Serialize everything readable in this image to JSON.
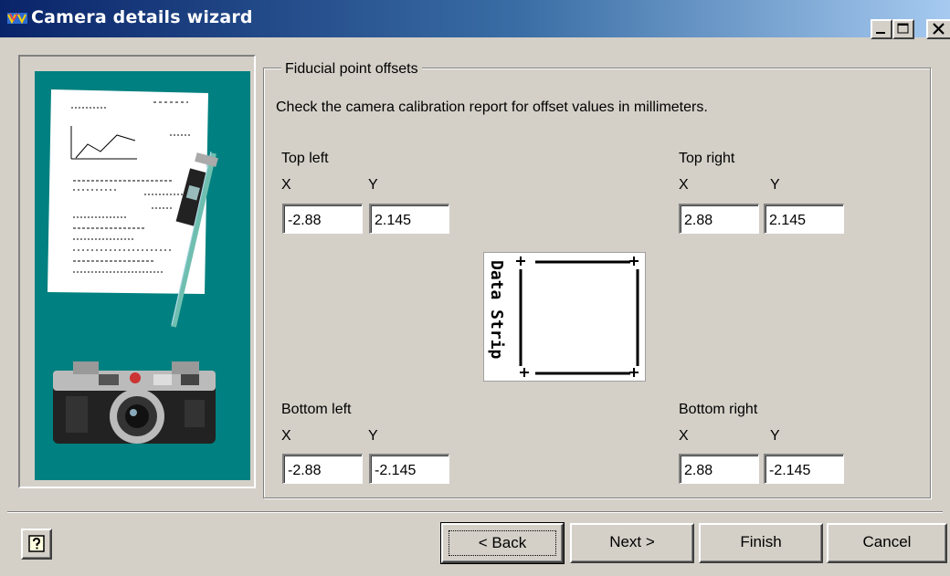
{
  "window": {
    "title": "Camera details wizard"
  },
  "group": {
    "legend": "Fiducial point offsets",
    "instruction": "Check the camera calibration report for offset values in millimeters."
  },
  "corners": {
    "top_left": {
      "label": "Top left",
      "x_label": "X",
      "y_label": "Y",
      "x": "-2.88",
      "y": "2.145"
    },
    "top_right": {
      "label": "Top right",
      "x_label": "X",
      "y_label": "Y",
      "x": "2.88",
      "y": "2.145"
    },
    "bottom_left": {
      "label": "Bottom left",
      "x_label": "X",
      "y_label": "Y",
      "x": "-2.88",
      "y": "-2.145"
    },
    "bottom_right": {
      "label": "Bottom right",
      "x_label": "X",
      "y_label": "Y",
      "x": "2.88",
      "y": "-2.145"
    }
  },
  "diagram": {
    "strip_text": "Data Strip"
  },
  "buttons": {
    "help": "help-icon",
    "back": "< Back",
    "next": "Next >",
    "finish": "Finish",
    "cancel": "Cancel"
  },
  "colors": {
    "titlebar_start": "#0a246a",
    "titlebar_end": "#a6caf0",
    "picture_bg": "#008080",
    "dialog_bg": "#d4d0c8"
  }
}
